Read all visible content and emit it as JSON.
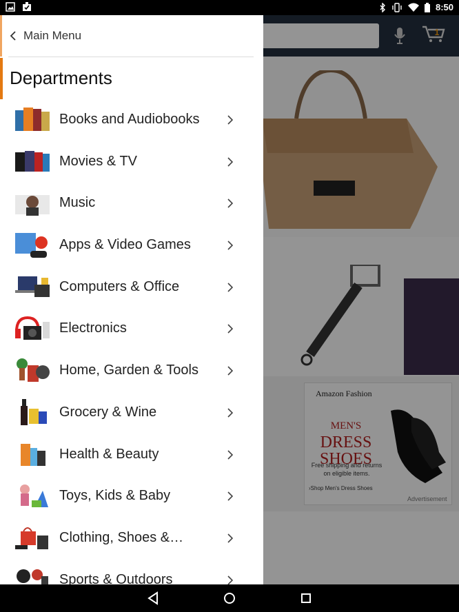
{
  "status_bar": {
    "time": "8:50",
    "left_icons": [
      "image-icon",
      "download-check-icon"
    ],
    "right_icons": [
      "bluetooth-icon",
      "vibrate-icon",
      "wifi-icon",
      "battery-icon"
    ]
  },
  "header": {
    "cart_count": "1"
  },
  "drawer": {
    "back_label": "Main Menu",
    "heading": "Departments",
    "items": [
      {
        "label": "Books and Audiobooks",
        "thumb": "books-thumb"
      },
      {
        "label": "Movies & TV",
        "thumb": "movies-thumb"
      },
      {
        "label": "Music",
        "thumb": "music-thumb"
      },
      {
        "label": "Apps & Video Games",
        "thumb": "apps-thumb"
      },
      {
        "label": "Computers & Office",
        "thumb": "computers-thumb"
      },
      {
        "label": "Electronics",
        "thumb": "electronics-thumb"
      },
      {
        "label": "Home, Garden & Tools",
        "thumb": "home-thumb"
      },
      {
        "label": "Grocery & Wine",
        "thumb": "grocery-thumb"
      },
      {
        "label": "Health & Beauty",
        "thumb": "health-thumb"
      },
      {
        "label": "Toys, Kids & Baby",
        "thumb": "toys-thumb"
      },
      {
        "label": "Clothing, Shoes &…",
        "thumb": "clothing-thumb"
      },
      {
        "label": "Sports & Outdoors",
        "thumb": "sports-thumb"
      }
    ]
  },
  "ad": {
    "brand": "Amazon Fashion",
    "title_small": "MEN'S",
    "title_big1": "DRESS",
    "title_big2": "SHOES",
    "sub": "Free shipping and returns on eligible items.",
    "link": "›Shop Men's Dress Shoes",
    "label": "Advertisement"
  },
  "colors": {
    "accent": "#e47911",
    "header_bg": "#232f3e"
  }
}
